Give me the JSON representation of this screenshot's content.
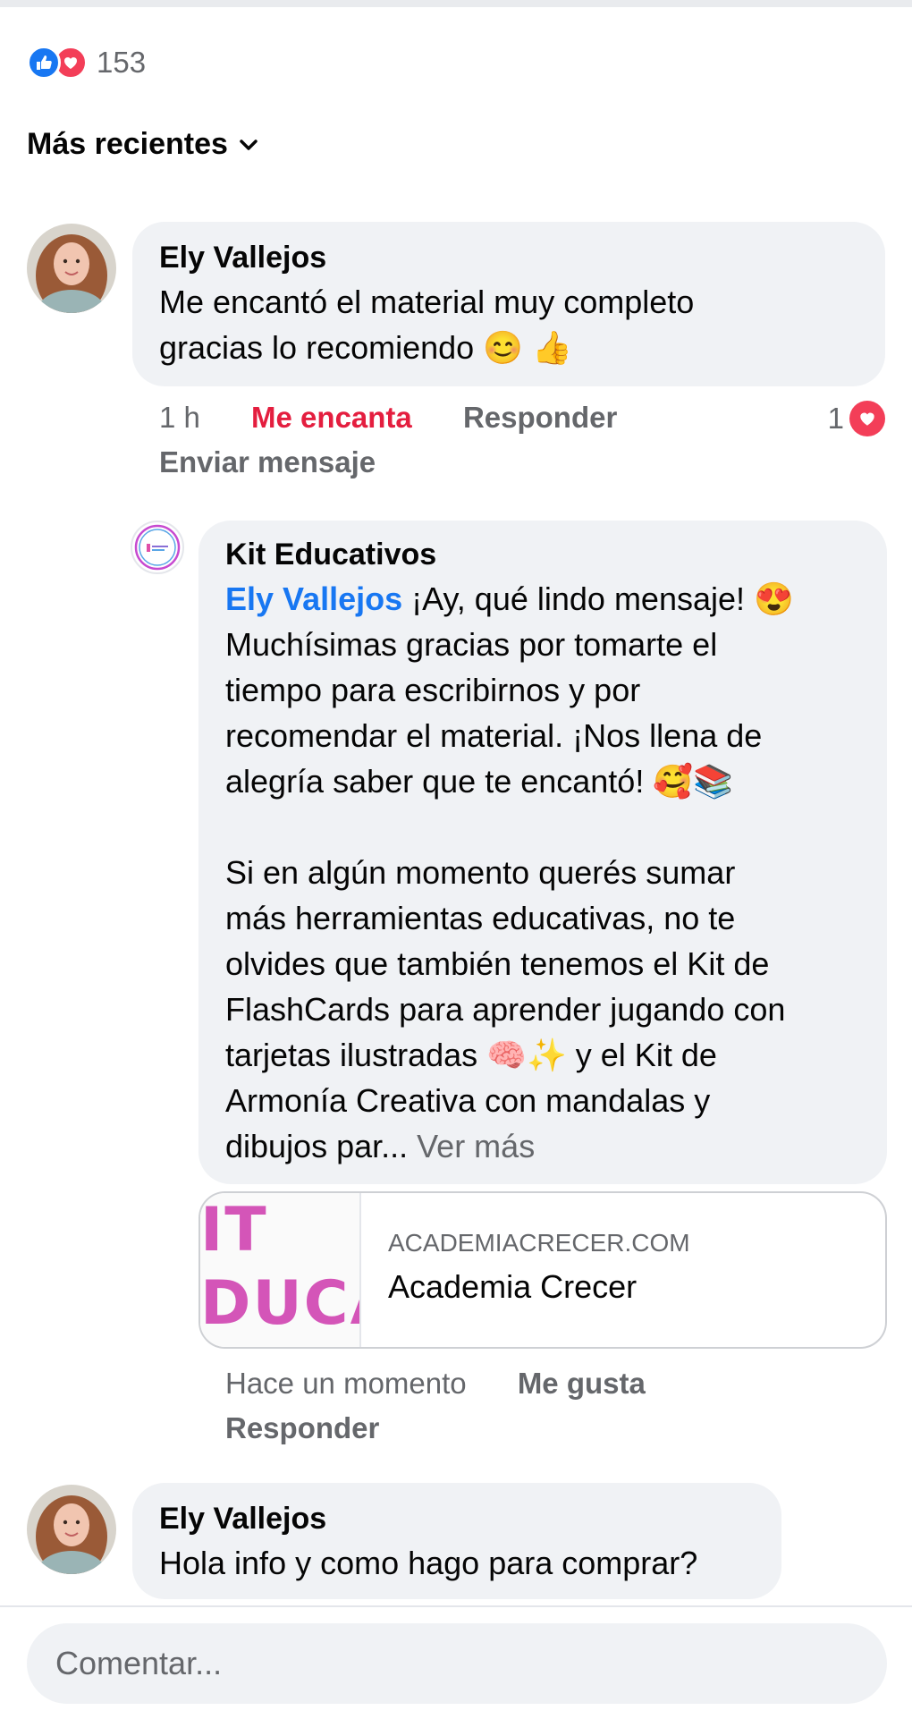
{
  "reactions": {
    "count": "153",
    "icons": [
      "like-icon",
      "love-icon"
    ]
  },
  "sort_label": "Más recientes",
  "comments": [
    {
      "author": "Ely Vallejos",
      "text": "Me encantó el material muy completo\ngracias lo recomiendo 😊 👍",
      "time": "1 h",
      "reaction_label": "Me encanta",
      "reply_label": "Responder",
      "reaction_count": "1",
      "message_label": "Enviar mensaje"
    },
    {
      "author": "Kit Educativos",
      "mention": "Ely Vallejos",
      "text": " ¡Ay, qué lindo mensaje! 😍\nMuchísimas gracias por tomarte el\ntiempo para escribirnos y por\nrecomendar el material. ¡Nos llena de\nalegría saber que te encantó! 🥰📚\n\nSi en algún momento querés sumar\nmás herramientas educativas, no te\nolvides que también tenemos el Kit de\nFlashCards para aprender jugando con\ntarjetas ilustradas 🧠✨ y el Kit de\nArmonía Creativa con mandalas y\ndibujos par...",
      "see_more": " Ver más",
      "link": {
        "domain": "ACADEMIACRECER.COM",
        "title": "Academia Crecer",
        "thumb_lines": [
          "IT",
          "DUCA"
        ]
      },
      "time": "Hace un momento",
      "like_label": "Me gusta",
      "reply_label": "Responder"
    },
    {
      "author": "Ely Vallejos",
      "text": "Hola info y como hago para comprar?"
    }
  ],
  "composer": {
    "placeholder": "Comentar..."
  },
  "colors": {
    "like": "#1877f2",
    "love": "#f33e58",
    "loved_text": "#e41e3f",
    "bubble": "#f0f2f5",
    "muted": "#65676b"
  }
}
